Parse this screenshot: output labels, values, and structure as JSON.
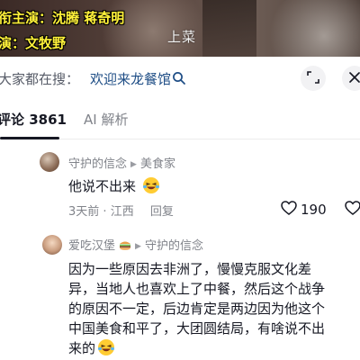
{
  "video": {
    "credit_line1": "衔主演：沈腾  蒋奇明",
    "credit_line2": "演：文牧野",
    "caption": "上菜"
  },
  "search": {
    "prefix": "大家都在搜：",
    "term": "欢迎来龙餐馆"
  },
  "tabs": {
    "comments_label": "评论 3861",
    "ai_label": "AI 解析"
  },
  "comments": [
    {
      "author": "守护的信念",
      "reply_to": "美食家",
      "text": "他说不出来",
      "time": "3天前",
      "location": "江西",
      "reply_label": "回复",
      "likes": "190"
    },
    {
      "author": "爱吃汉堡",
      "reply_to": "守护的信念",
      "lines": [
        "因为一些原因去非洲了，慢慢克服文化差",
        "异，当地人也喜欢上了中餐，然后这个战争",
        "的原因不一定，后边肯定是两边因为他这个",
        "中国美食和平了，大团圆结局，有啥说不出",
        "来的"
      ]
    }
  ],
  "icons": {
    "search": "search-icon",
    "expand": "expand-icon",
    "close": "close-icon",
    "heart": "heart-icon",
    "emoji": "laughing-crying-emoji",
    "burger": "hamburger-emoji"
  },
  "colors": {
    "credit_text": "#fff23a",
    "link": "#1f4e86",
    "muted": "#80838a",
    "text": "#161823"
  }
}
